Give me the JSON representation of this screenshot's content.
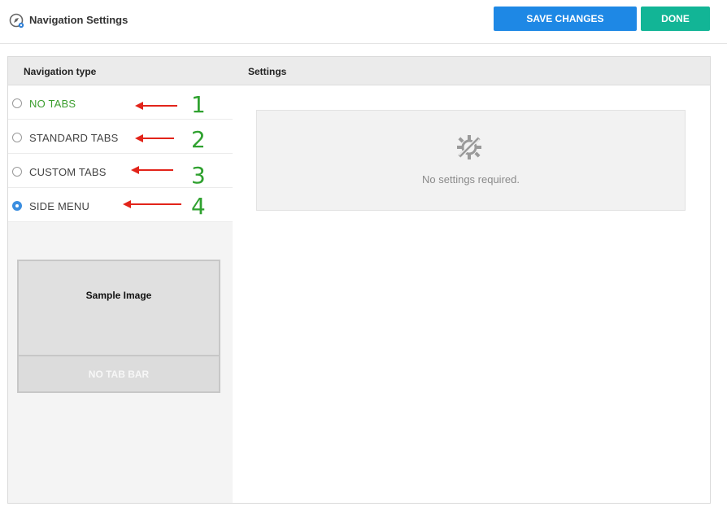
{
  "header": {
    "title": "Navigation Settings",
    "save_label": "SAVE CHANGES",
    "done_label": "DONE",
    "app_icon": "compass-gear-icon"
  },
  "colors": {
    "save_button": "#1e88e5",
    "done_button": "#12b596",
    "selected_option": "#3c9e2f",
    "radio_checked": "#3b8ee0",
    "annotation_arrow": "#e2241a",
    "annotation_number": "#2fa12f"
  },
  "panel": {
    "nav_header": "Navigation type",
    "settings_header": "Settings"
  },
  "options": [
    {
      "label": "NO TABS",
      "annotation": "1",
      "state": "highlighted"
    },
    {
      "label": "STANDARD TABS",
      "annotation": "2",
      "state": "normal"
    },
    {
      "label": "CUSTOM TABS",
      "annotation": "3",
      "state": "normal"
    },
    {
      "label": "SIDE MENU",
      "annotation": "4",
      "state": "checked"
    }
  ],
  "sample": {
    "title": "Sample Image",
    "bar_label": "NO TAB BAR"
  },
  "settings": {
    "empty_text": "No settings required.",
    "icon": "tools-disabled-icon"
  }
}
